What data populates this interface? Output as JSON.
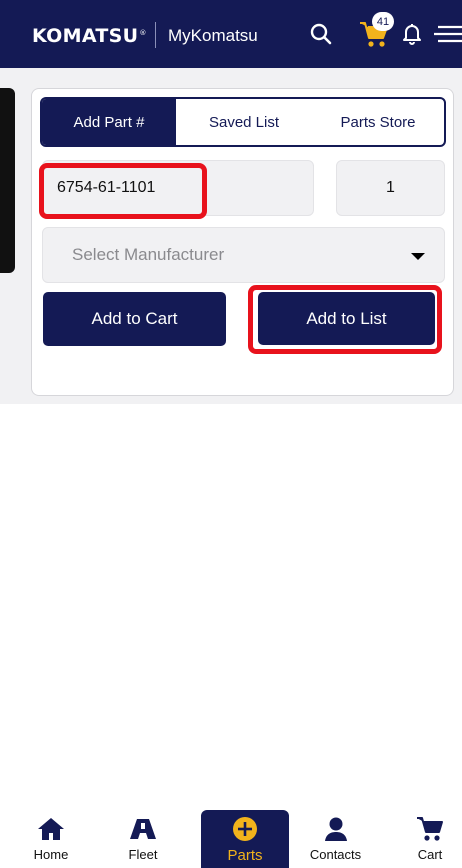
{
  "header": {
    "logo_text": "KOMATSU",
    "logo_mark": "®",
    "app_name": "MyKomatsu",
    "cart_count": "41",
    "icons": [
      "search-icon",
      "cart-icon",
      "bell-icon",
      "menu-icon"
    ]
  },
  "tabs": [
    {
      "label": "Add Part #",
      "active": true
    },
    {
      "label": "Saved List",
      "active": false
    },
    {
      "label": "Parts Store",
      "active": false
    }
  ],
  "form": {
    "part_number": "6754-61-1101",
    "quantity": "1",
    "manufacturer_placeholder": "Select Manufacturer"
  },
  "buttons": {
    "add_to_cart": "Add to Cart",
    "add_to_list": "Add to List"
  },
  "bottom_nav": [
    {
      "label": "Home",
      "icon": "home-icon",
      "active": false
    },
    {
      "label": "Fleet",
      "icon": "fleet-icon",
      "active": false
    },
    {
      "label": "Parts",
      "icon": "plus-circle-icon",
      "active": true
    },
    {
      "label": "Contacts",
      "icon": "person-icon",
      "active": false
    },
    {
      "label": "Cart",
      "icon": "cart-icon",
      "active": false
    }
  ],
  "colors": {
    "brand_navy": "#141a55",
    "accent_yellow": "#f2b31c",
    "highlight_red": "#e8121c",
    "panel_gray": "#f1f1f3"
  }
}
